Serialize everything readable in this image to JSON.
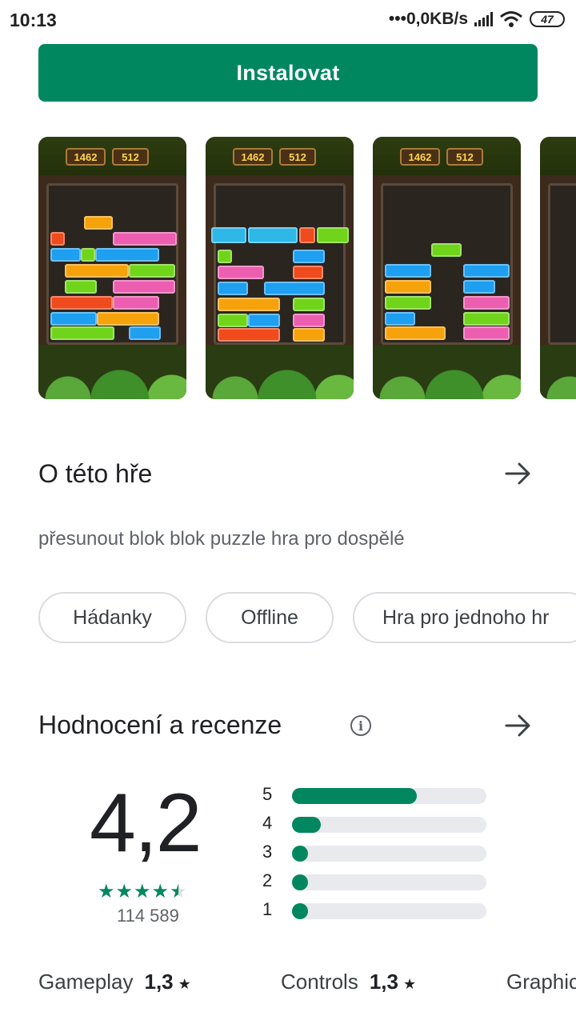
{
  "status_bar": {
    "time": "10:13",
    "network": "•••0,0KB/s",
    "battery": "47"
  },
  "install": {
    "label": "Instalovat"
  },
  "screenshots": [
    {
      "best": "1462",
      "score": "512"
    },
    {
      "best": "1462",
      "score": "512"
    },
    {
      "best": "1462",
      "score": "512"
    }
  ],
  "about": {
    "title": "O této hře",
    "description": "přesunout blok blok puzzle hra pro dospělé"
  },
  "tags": [
    "Hádanky",
    "Offline",
    "Hra pro jednoho hr"
  ],
  "ratings": {
    "title": "Hodnocení a recenze",
    "average": "4,2",
    "stars_value": 4.2,
    "review_count": "114 589",
    "distribution": [
      {
        "label": "5",
        "fraction": 0.64
      },
      {
        "label": "4",
        "fraction": 0.15
      },
      {
        "label": "3",
        "fraction": 0.08
      },
      {
        "label": "2",
        "fraction": 0.08
      },
      {
        "label": "1",
        "fraction": 0.08
      }
    ],
    "sub": [
      {
        "name": "Gameplay",
        "value": "1,3"
      },
      {
        "name": "Controls",
        "value": "1,3"
      },
      {
        "name": "Graphic",
        "value": ""
      }
    ]
  },
  "colors": {
    "accent": "#01875f"
  }
}
